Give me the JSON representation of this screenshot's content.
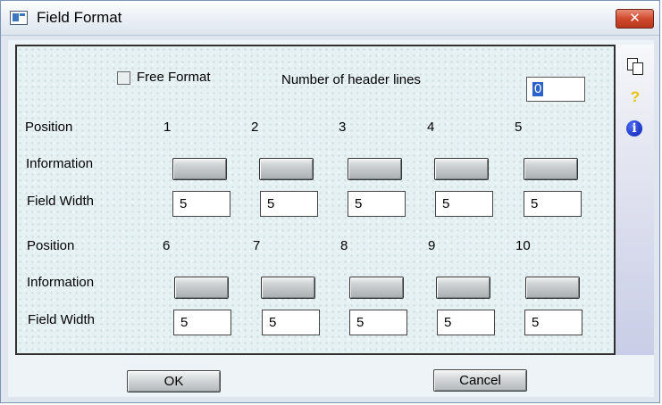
{
  "window": {
    "title": "Field Format",
    "close_glyph": "✕"
  },
  "header": {
    "free_format_label": "Free Format",
    "free_format_checked": false,
    "header_lines_label": "Number of header lines",
    "header_lines_value": "0"
  },
  "row_labels": {
    "position": "Position",
    "information": "Information",
    "field_width": "Field Width"
  },
  "groups": [
    {
      "positions": [
        "1",
        "2",
        "3",
        "4",
        "5"
      ],
      "widths": [
        "5",
        "5",
        "5",
        "5",
        "5"
      ]
    },
    {
      "positions": [
        "6",
        "7",
        "8",
        "9",
        "10"
      ],
      "widths": [
        "5",
        "5",
        "5",
        "5",
        "5"
      ]
    }
  ],
  "side_icons": [
    "copy-icon",
    "help-icon",
    "info-icon"
  ],
  "side_glyphs": {
    "help": "?",
    "info": "i"
  },
  "buttons": {
    "ok": "OK",
    "cancel": "Cancel"
  }
}
